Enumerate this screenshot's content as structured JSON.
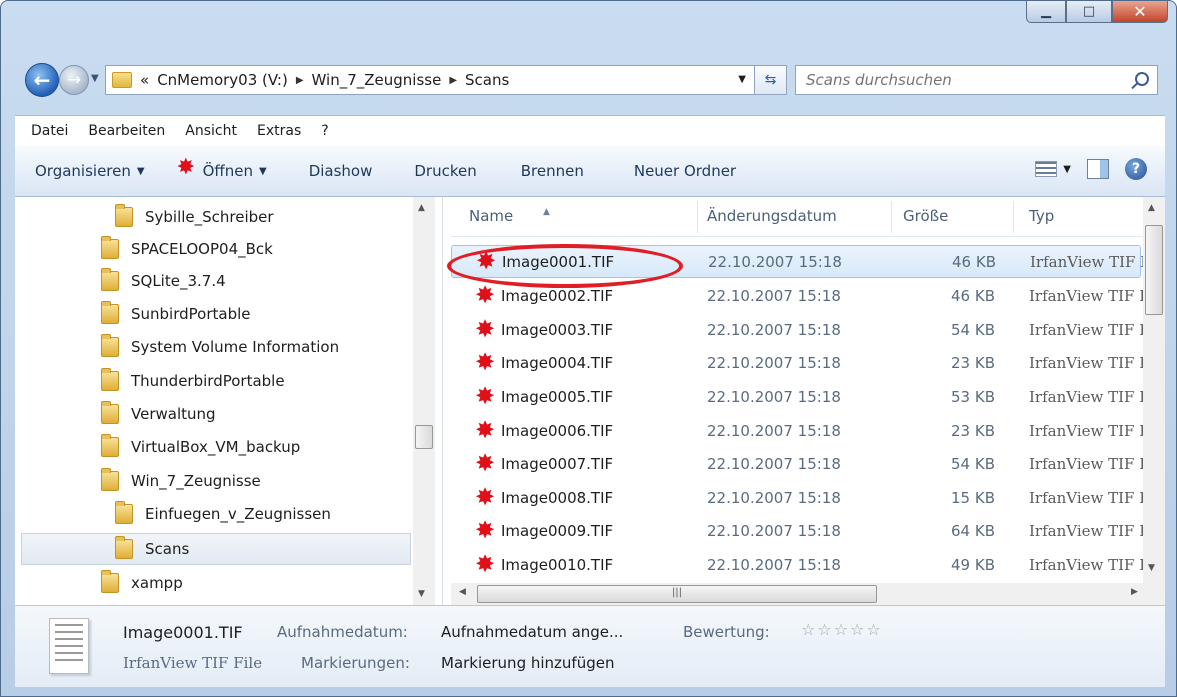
{
  "window": {
    "caption_buttons": {
      "minimize": "▁",
      "maximize": "□",
      "close": "✕"
    }
  },
  "address": {
    "prefix": "«",
    "crumbs": [
      "CnMemory03 (V:)",
      "Win_7_Zeugnisse",
      "Scans"
    ],
    "search_placeholder": "Scans durchsuchen"
  },
  "menu": [
    "Datei",
    "Bearbeiten",
    "Ansicht",
    "Extras",
    "?"
  ],
  "toolbar": {
    "organize": "Organisieren",
    "open": "Öffnen",
    "slideshow": "Diashow",
    "print": "Drucken",
    "burn": "Brennen",
    "new_folder": "Neuer Ordner"
  },
  "tree": {
    "items": [
      {
        "label": "Sybille_Schreiber"
      },
      {
        "label": "SPACELOOP04_Bck"
      },
      {
        "label": "SQLite_3.7.4"
      },
      {
        "label": "SunbirdPortable"
      },
      {
        "label": "System Volume Information"
      },
      {
        "label": "ThunderbirdPortable"
      },
      {
        "label": "Verwaltung"
      },
      {
        "label": "VirtualBox_VM_backup"
      },
      {
        "label": "Win_7_Zeugnisse"
      },
      {
        "label": "Einfuegen_v_Zeugnissen"
      },
      {
        "label": "Scans",
        "selected": true
      },
      {
        "label": "xampp"
      }
    ]
  },
  "columns": {
    "name": "Name",
    "date": "Änderungsdatum",
    "size": "Größe",
    "type": "Typ"
  },
  "files": [
    {
      "name": "Image0001.TIF",
      "date": "22.10.2007 15:18",
      "size": "46 KB",
      "type": "IrfanView TIF F",
      "selected": true
    },
    {
      "name": "Image0002.TIF",
      "date": "22.10.2007 15:18",
      "size": "46 KB",
      "type": "IrfanView TIF F"
    },
    {
      "name": "Image0003.TIF",
      "date": "22.10.2007 15:18",
      "size": "54 KB",
      "type": "IrfanView TIF F"
    },
    {
      "name": "Image0004.TIF",
      "date": "22.10.2007 15:18",
      "size": "23 KB",
      "type": "IrfanView TIF F"
    },
    {
      "name": "Image0005.TIF",
      "date": "22.10.2007 15:18",
      "size": "53 KB",
      "type": "IrfanView TIF F"
    },
    {
      "name": "Image0006.TIF",
      "date": "22.10.2007 15:18",
      "size": "23 KB",
      "type": "IrfanView TIF F"
    },
    {
      "name": "Image0007.TIF",
      "date": "22.10.2007 15:18",
      "size": "54 KB",
      "type": "IrfanView TIF F"
    },
    {
      "name": "Image0008.TIF",
      "date": "22.10.2007 15:18",
      "size": "15 KB",
      "type": "IrfanView TIF F"
    },
    {
      "name": "Image0009.TIF",
      "date": "22.10.2007 15:18",
      "size": "64 KB",
      "type": "IrfanView TIF F"
    },
    {
      "name": "Image0010.TIF",
      "date": "22.10.2007 15:18",
      "size": "49 KB",
      "type": "IrfanView TIF F"
    }
  ],
  "details": {
    "file_name": "Image0001.TIF",
    "file_type": "IrfanView TIF File",
    "date_taken_label": "Aufnahmedatum:",
    "date_taken_value": "Aufnahmedatum ange...",
    "tags_label": "Markierungen:",
    "tags_value": "Markierung hinzufügen",
    "rating_label": "Bewertung:",
    "rating_stars": "☆☆☆☆☆"
  },
  "colors": {
    "highlight_ring": "#e01e25",
    "selection": "#d7e9fa",
    "splat_icon": "#e0101b"
  }
}
